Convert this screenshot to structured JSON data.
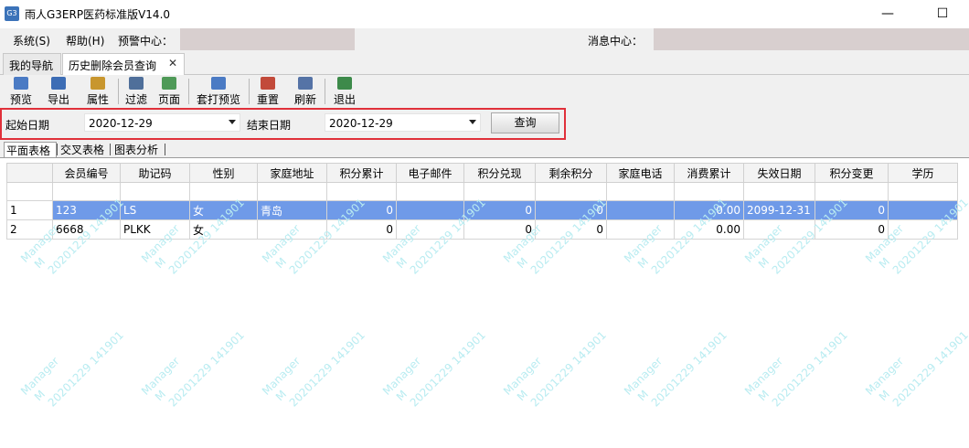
{
  "window": {
    "title": "雨人G3ERP医药标准版V14.0",
    "app_icon": "G3",
    "minimize": "—",
    "maximize": "☐"
  },
  "menubar": {
    "system": "系统(S)",
    "help": "帮助(H)",
    "alert_center": "预警中心：",
    "message_center": "消息中心："
  },
  "tabs": [
    {
      "label": "我的导航"
    },
    {
      "label": "历史删除会员查询"
    }
  ],
  "tab_close": "✕",
  "toolbar": [
    {
      "label": "预览",
      "icon": "preview-icon",
      "color": "#4b7bc4"
    },
    {
      "label": "导出",
      "icon": "export-icon",
      "color": "#3d6db5"
    },
    {
      "label": "属性",
      "icon": "properties-icon",
      "color": "#c8962e"
    },
    {
      "label": "过滤",
      "icon": "filter-icon",
      "color": "#4f6f9a"
    },
    {
      "label": "页面",
      "icon": "page-icon",
      "color": "#4f9a58"
    },
    {
      "label": "套打预览",
      "icon": "print-preview-icon",
      "color": "#4b7bc4"
    },
    {
      "label": "重置",
      "icon": "reset-icon",
      "color": "#c24a3a"
    },
    {
      "label": "刷新",
      "icon": "refresh-icon",
      "color": "#5573a6"
    },
    {
      "label": "退出",
      "icon": "exit-icon",
      "color": "#3d8a4a"
    }
  ],
  "filter": {
    "start_label": "起始日期",
    "start_value": "2020-12-29",
    "end_label": "结束日期",
    "end_value": "2020-12-29",
    "query_button": "查询",
    "highlight_color": "#e0303a"
  },
  "view_tabs": [
    "平面表格",
    "交叉表格",
    "图表分析"
  ],
  "grid": {
    "columns": [
      "会员编号",
      "助记码",
      "性别",
      "家庭地址",
      "积分累计",
      "电子邮件",
      "积分兑现",
      "剩余积分",
      "家庭电话",
      "消费累计",
      "失效日期",
      "积分变更",
      "学历"
    ],
    "rows": [
      [
        "1",
        "123",
        "LS",
        "女",
        "青岛",
        "0",
        "",
        "0",
        "0",
        "",
        "0.00",
        "2099-12-31",
        "0",
        ""
      ],
      [
        "2",
        "6668",
        "PLKK",
        "女",
        "",
        "0",
        "",
        "0",
        "0",
        "",
        "0.00",
        "",
        "0",
        ""
      ]
    ],
    "selected_row": 0,
    "selection_color": "#6f9ae8"
  },
  "watermark": {
    "line1": "Manager",
    "line2": "M",
    "line3": "20201229 141901"
  }
}
